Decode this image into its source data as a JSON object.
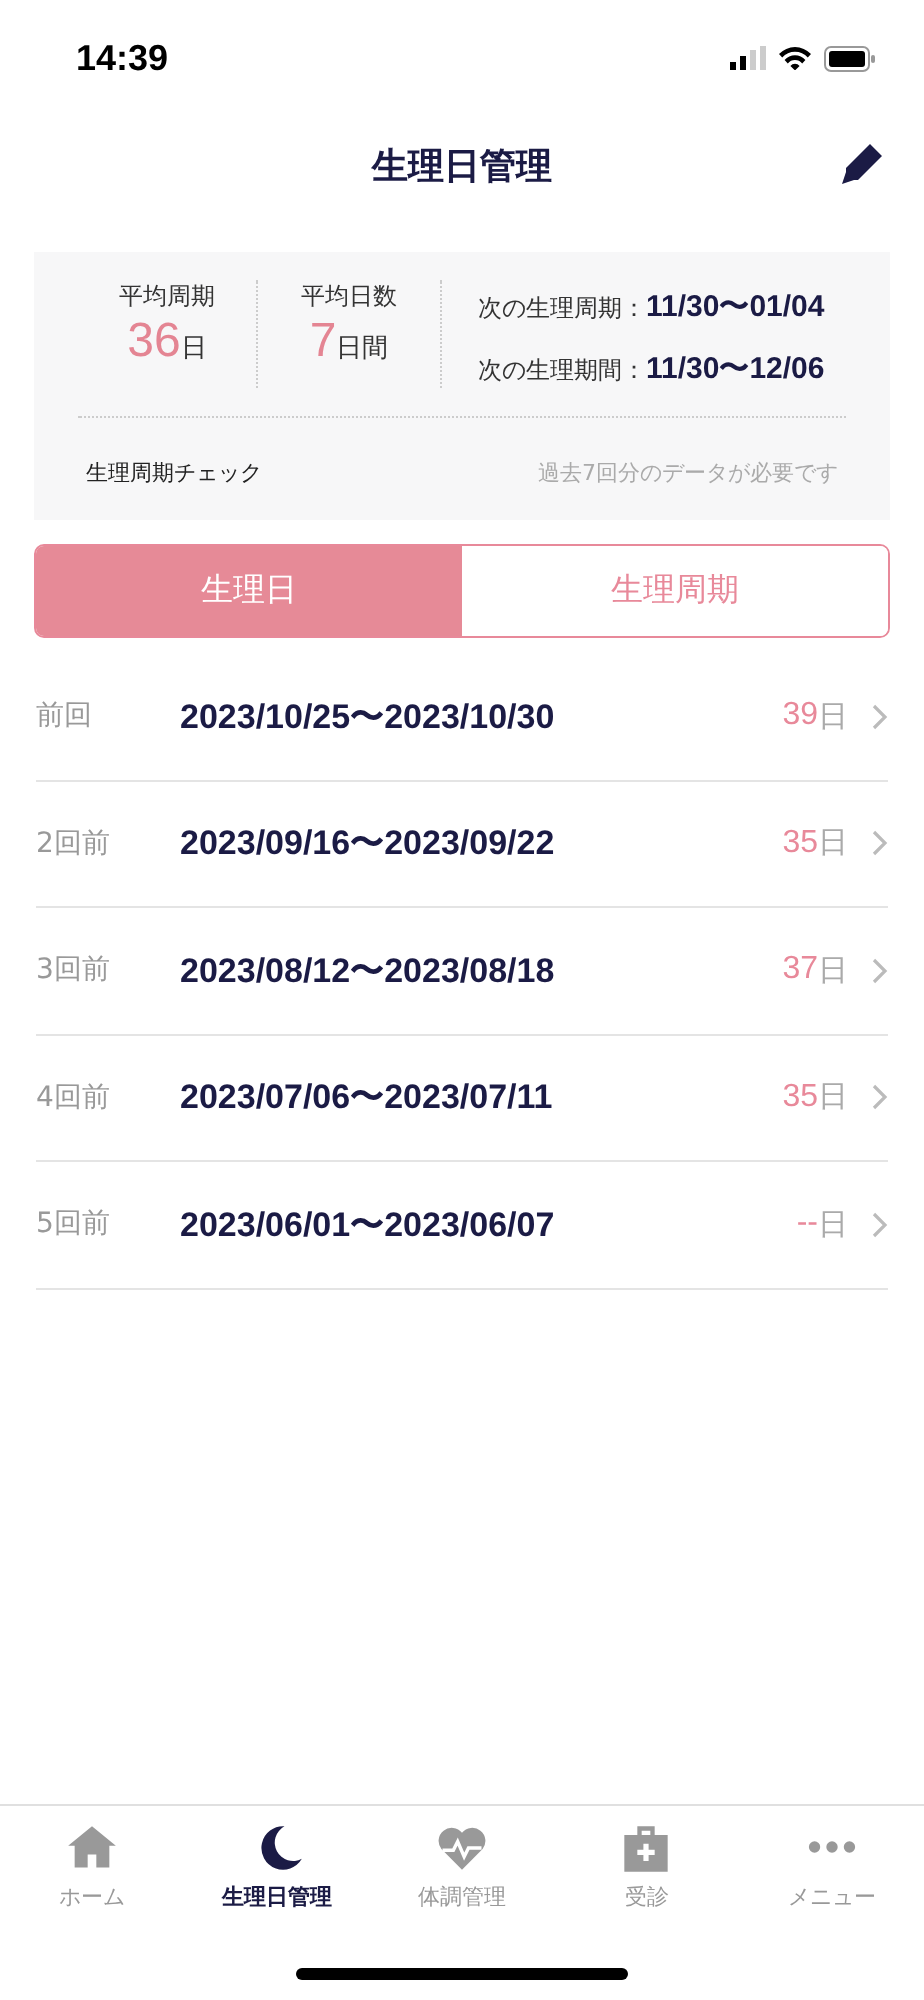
{
  "status_bar": {
    "time": "14:39"
  },
  "header": {
    "title": "生理日管理"
  },
  "summary": {
    "stats": [
      {
        "label": "平均周期",
        "value": "36",
        "unit": "日"
      },
      {
        "label": "平均日数",
        "value": "7",
        "unit": "日間"
      }
    ],
    "next": [
      {
        "label": "次の生理周期：",
        "value": "11/30〜01/04"
      },
      {
        "label": "次の生理期間：",
        "value": "11/30〜12/06"
      }
    ],
    "check": {
      "label": "生理周期チェック",
      "note": "過去7回分のデータが必要です"
    }
  },
  "tabs": [
    {
      "label": "生理日",
      "selected": true
    },
    {
      "label": "生理周期",
      "selected": false
    }
  ],
  "history": [
    {
      "label": "前回",
      "range": "2023/10/25〜2023/10/30",
      "days": "39",
      "unit": "日"
    },
    {
      "label": "2回前",
      "range": "2023/09/16〜2023/09/22",
      "days": "35",
      "unit": "日"
    },
    {
      "label": "3回前",
      "range": "2023/08/12〜2023/08/18",
      "days": "37",
      "unit": "日"
    },
    {
      "label": "4回前",
      "range": "2023/07/06〜2023/07/11",
      "days": "35",
      "unit": "日"
    },
    {
      "label": "5回前",
      "range": "2023/06/01〜2023/06/07",
      "days": "--",
      "unit": "日"
    }
  ],
  "tab_bar": [
    {
      "kind": "home",
      "label": "ホーム",
      "selected": false
    },
    {
      "kind": "moon",
      "label": "生理日管理",
      "selected": true
    },
    {
      "kind": "heart",
      "label": "体調管理",
      "selected": false
    },
    {
      "kind": "clinic",
      "label": "受診",
      "selected": false
    },
    {
      "kind": "more",
      "label": "メニュー",
      "selected": false
    }
  ]
}
